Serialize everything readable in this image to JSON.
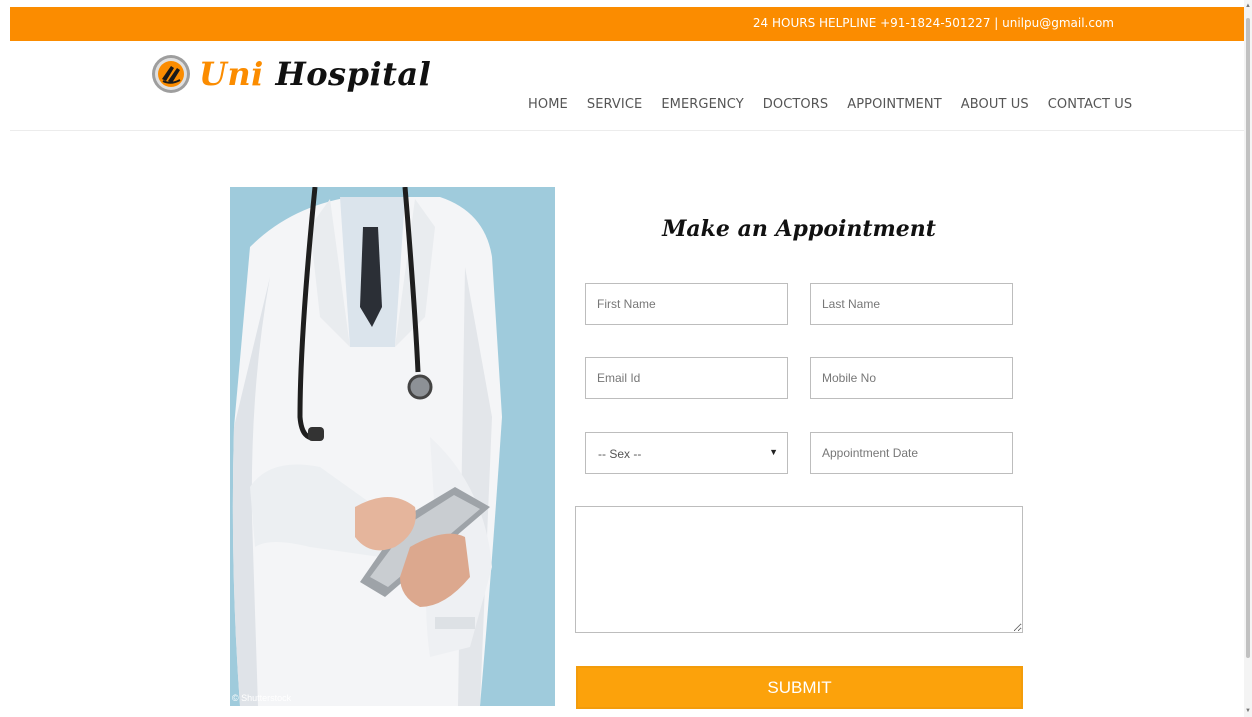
{
  "topbar": {
    "helpline": "24 HOURS HELPLINE +91-1824-501227 | unilpu@gmail.com",
    "background": "#fb8c00"
  },
  "header": {
    "logo": {
      "prefix": "Uni",
      "suffix": "Hospital",
      "emblem_icon": "university-emblem-icon"
    },
    "nav": [
      "HOME",
      "SERVICE",
      "EMERGENCY",
      "DOCTORS",
      "APPOINTMENT",
      "ABOUT US",
      "CONTACT US"
    ]
  },
  "photo": {
    "subject": "doctor-with-stethoscope-and-tablet",
    "credit": "© Shutterstock"
  },
  "form": {
    "title": "Make an Appointment",
    "first_name": {
      "placeholder": "First Name",
      "value": ""
    },
    "last_name": {
      "placeholder": "Last Name",
      "value": ""
    },
    "email": {
      "placeholder": "Email Id",
      "value": ""
    },
    "mobile": {
      "placeholder": "Mobile No",
      "value": ""
    },
    "sex": {
      "selected": "-- Sex --"
    },
    "appointment_date": {
      "placeholder": "Appointment Date",
      "value": ""
    },
    "message": {
      "value": ""
    },
    "submit_label": "SUBMIT",
    "accent": "#fca20b"
  }
}
